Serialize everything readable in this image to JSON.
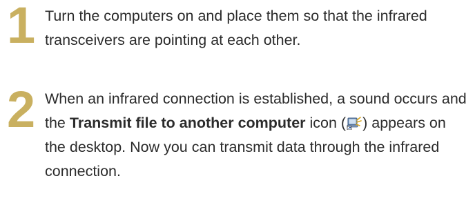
{
  "steps": [
    {
      "number": "1",
      "text": "Turn the computers on and place them so that the infrared transceivers are pointing at each other."
    },
    {
      "number": "2",
      "text_part1": "When an infrared connection is established, a sound occurs and the ",
      "bold_text": "Transmit file to another computer",
      "text_part2": " icon (",
      "icon": "infrared-transmit-icon",
      "text_part3": ") appears on the desktop. Now you can transmit data through the infrared connection."
    }
  ],
  "colors": {
    "step_number": "#c9b060",
    "body_text": "#2b2b2b"
  }
}
